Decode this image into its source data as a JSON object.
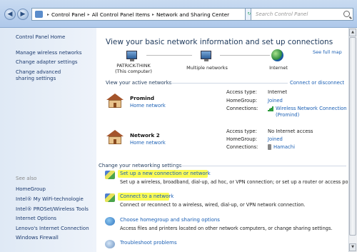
{
  "address_bar": {
    "back_icon": "back-arrow-icon",
    "forward_icon": "forward-arrow-icon",
    "crumbs": [
      "Control Panel",
      "All Control Panel Items",
      "Network and Sharing Center"
    ],
    "search_placeholder": "Search Control Panel"
  },
  "sidebar": {
    "home": "Control Panel Home",
    "links": [
      "Manage wireless networks",
      "Change adapter settings",
      "Change advanced sharing settings"
    ],
    "see_also_header": "See also",
    "see_also": [
      "HomeGroup",
      "Intel® My WiFi-technologie",
      "Intel® PROSet/Wireless Tools",
      "Internet Options",
      "Lenovo's Internet Connection",
      "Windows Firewall"
    ]
  },
  "main": {
    "title": "View your basic network information and set up connections",
    "see_full_map": "See full map",
    "map": {
      "computer": "PATRICK-THINK",
      "computer_sub": "(This computer)",
      "middle": "Multiple networks",
      "internet": "Internet"
    },
    "active_header": "View your active networks",
    "connect_disconnect": "Connect or disconnect",
    "networks": [
      {
        "name": "Promind",
        "type": "Home network",
        "access_label": "Access type:",
        "access_value": "Internet",
        "homegroup_label": "HomeGroup:",
        "homegroup_value": "Joined",
        "connections_label": "Connections:",
        "connections_value": "Wireless Network Connection",
        "connections_value2": "(Promind)"
      },
      {
        "name": "Network  2",
        "type": "Home network",
        "access_label": "Access type:",
        "access_value": "No Internet access",
        "homegroup_label": "HomeGroup:",
        "homegroup_value": "Joined",
        "connections_label": "Connections:",
        "connections_value": "Hamachi"
      }
    ],
    "settings_header": "Change your networking settings",
    "tasks": [
      {
        "link": "Set up a new connection or network",
        "desc": "Set up a wireless, broadband, dial-up, ad hoc, or VPN connection; or set up a router or access point."
      },
      {
        "link": "Connect to a network",
        "desc": "Connect or reconnect to a wireless, wired, dial-up, or VPN network connection."
      },
      {
        "link": "Choose homegroup and sharing options",
        "desc": "Access files and printers located on other network computers, or change sharing settings."
      },
      {
        "link": "Troubleshoot problems",
        "desc": ""
      }
    ]
  },
  "colors": {
    "highlight": "#fbfb55",
    "link": "#1a5fb4",
    "title": "#1e395b"
  }
}
